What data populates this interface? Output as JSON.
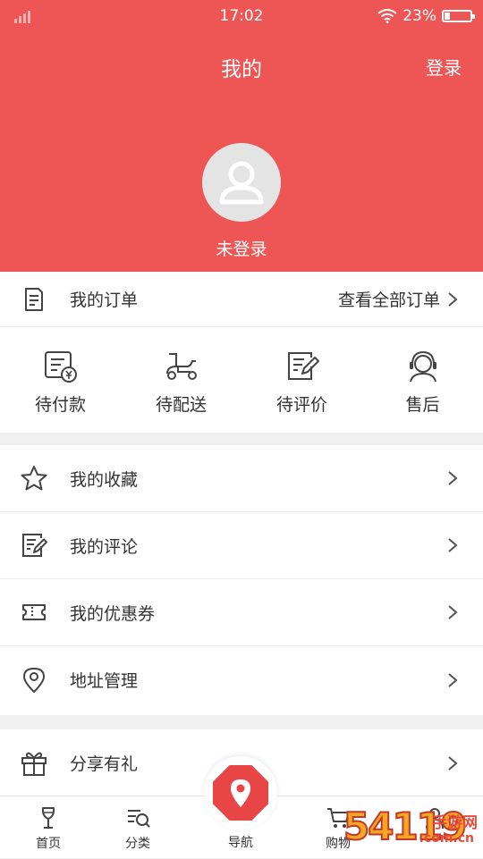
{
  "status_bar": {
    "time": "17:02",
    "battery": "23%",
    "battery_level": 0.23
  },
  "header": {
    "title": "我的",
    "login": "登录",
    "user_status": "未登录"
  },
  "orders": {
    "title": "我的订单",
    "view_all": "查看全部订单",
    "statuses": [
      {
        "label": "待付款",
        "icon": "pending-payment-icon"
      },
      {
        "label": "待配送",
        "icon": "delivery-scooter-icon"
      },
      {
        "label": "待评价",
        "icon": "pending-review-icon"
      },
      {
        "label": "售后",
        "icon": "customer-service-icon"
      }
    ]
  },
  "menu": [
    {
      "label": "我的收藏",
      "icon": "star-icon"
    },
    {
      "label": "我的评论",
      "icon": "comment-edit-icon"
    },
    {
      "label": "我的优惠券",
      "icon": "coupon-icon"
    },
    {
      "label": "地址管理",
      "icon": "location-icon"
    }
  ],
  "menu2": [
    {
      "label": "分享有礼",
      "icon": "gift-icon"
    }
  ],
  "bottom_nav": [
    {
      "label": "首页",
      "icon": "wine-glass-icon"
    },
    {
      "label": "分类",
      "icon": "category-search-icon"
    },
    {
      "label": "导航",
      "icon": "map-pin-icon"
    },
    {
      "label": "购物",
      "icon": "cart-icon"
    }
  ],
  "watermark": {
    "text": "54119",
    "sub": "手游网",
    "domain": ".com.cn"
  },
  "colors": {
    "brand": "#ee5656",
    "nav_center": "#e84646"
  }
}
